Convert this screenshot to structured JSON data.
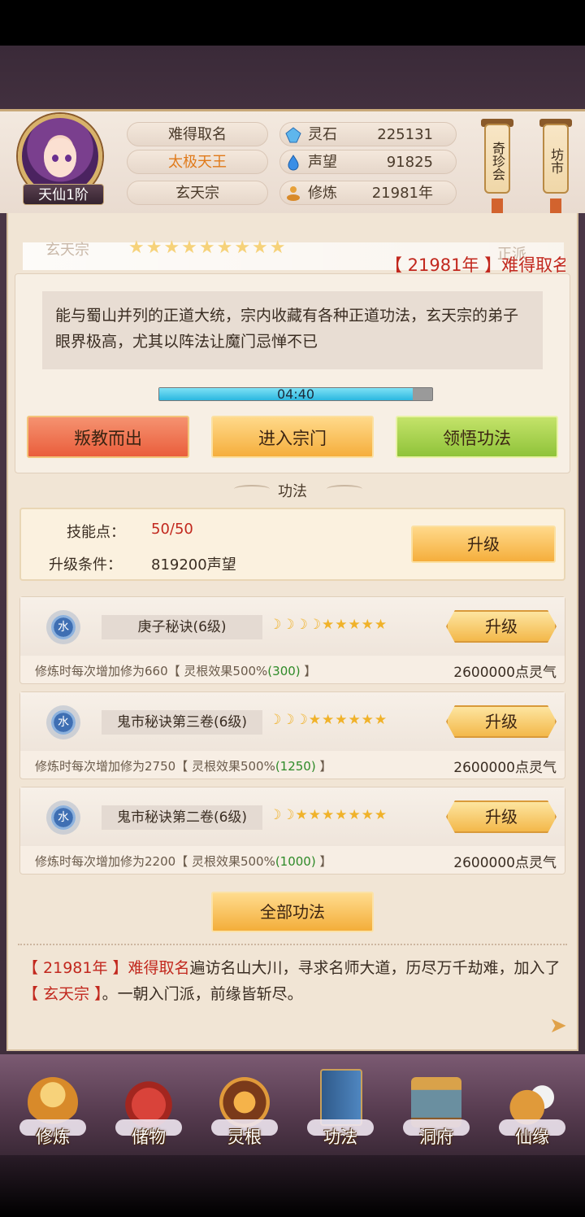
{
  "header": {
    "rank_badge": "天仙1阶",
    "names": [
      "难得取名",
      "太极天王",
      "玄天宗"
    ],
    "resources": [
      {
        "icon": "spirit-stone-icon",
        "label": "灵石",
        "value": "225131"
      },
      {
        "icon": "fame-drop-icon",
        "label": "声望",
        "value": "91825"
      },
      {
        "icon": "cultivation-icon",
        "label": "修炼",
        "value": "21981年"
      }
    ],
    "lanterns": [
      "奇珍会",
      "坊市"
    ]
  },
  "sect": {
    "name": "玄天宗",
    "type": "正派",
    "stars": "★★★★★★★★★",
    "marquee": "【 21981年 】难得取名",
    "description": "能与蜀山并列的正道大统，宗内收藏有各种正道功法，玄天宗的弟子眼界极高，尤其以阵法让魔门忌惮不已",
    "timer": "04:40",
    "timer_progress": 0.93,
    "buttons": [
      "叛教而出",
      "进入宗门",
      "领悟功法"
    ]
  },
  "skills": {
    "section_title": "功法",
    "points_label": "技能点：",
    "points_value": "50/50",
    "cond_label": "升级条件：",
    "cond_value": "819200声望",
    "upgrade_label": "升级"
  },
  "techniques": [
    {
      "element": "水",
      "name": "庚子秘诀(6级)",
      "level": "☽☽☽☽★★★★★",
      "button": "升级",
      "desc_pre": "修炼时每次增加修为660【 灵根效果500%",
      "desc_bonus": "(300)",
      "desc_post": " 】",
      "cost": "2600000点灵气"
    },
    {
      "element": "水",
      "name": "鬼市秘诀第三卷(6级)",
      "level": "☽☽☽★★★★★★",
      "button": "升级",
      "desc_pre": "修炼时每次增加修为2750【 灵根效果500%",
      "desc_bonus": "(1250)",
      "desc_post": " 】",
      "cost": "2600000点灵气"
    },
    {
      "element": "水",
      "name": "鬼市秘诀第二卷(6级)",
      "level": "☽☽★★★★★★★",
      "button": "升级",
      "desc_pre": "修炼时每次增加修为2200【 灵根效果500%",
      "desc_bonus": "(1000)",
      "desc_post": " 】",
      "cost": "2600000点灵气"
    }
  ],
  "all_techniques_button": "全部功法",
  "log": {
    "year": "【 21981年 】",
    "player": "难得取名",
    "text1": "遍访名山大川，寻求名师大道，历尽万千劫难，加入了",
    "sect": "【 玄天宗 】",
    "text2": "。一朝入门派，前缘皆斩尽。"
  },
  "nav": [
    {
      "label": "修炼",
      "icon": "cultivate-monk-icon"
    },
    {
      "label": "储物",
      "icon": "storage-bag-icon"
    },
    {
      "label": "灵根",
      "icon": "spirit-root-icon"
    },
    {
      "label": "功法",
      "icon": "technique-book-icon"
    },
    {
      "label": "洞府",
      "icon": "cave-mansion-icon"
    },
    {
      "label": "仙缘",
      "icon": "immortal-fate-icon"
    }
  ],
  "colors": {
    "accent_red": "#c2281e",
    "bonus_green": "#2e8a28",
    "gold": "#f3b84a"
  }
}
